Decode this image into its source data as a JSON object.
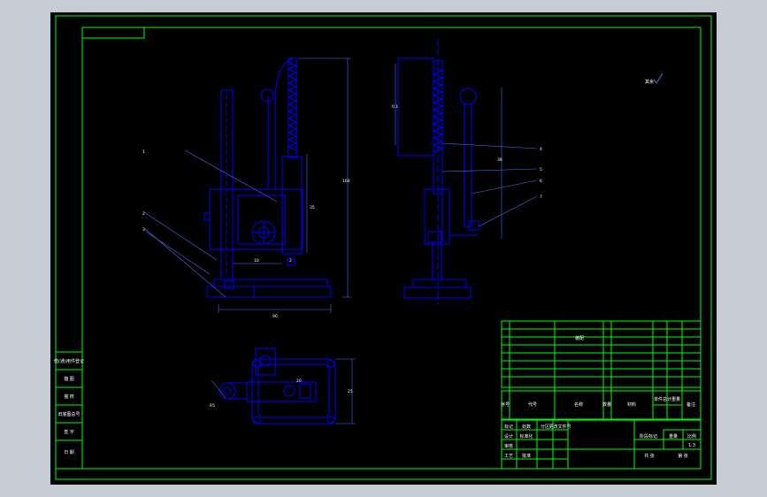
{
  "colors": {
    "frame": "#00ff00",
    "part": "#0000ff",
    "dim": "#4a6cff",
    "ink": "#ffffff",
    "background": "#000000",
    "chrome": "#c7cdd5"
  },
  "drawing": {
    "roughness_mark": "其余",
    "dimensions": {
      "front_height": "160",
      "front_width": "90",
      "front_body_height": "35",
      "front_inner_width": "10",
      "front_base_gap": "2",
      "side_spring": "0.1",
      "side_height": "38",
      "top_depth": "25",
      "top_length": "20",
      "top_radius": "R5"
    },
    "balloons": [
      "1",
      "2",
      "3",
      "4",
      "5",
      "6",
      "7",
      "8"
    ]
  },
  "left_column": [
    "借(通)用件登记",
    "描 图",
    "描 校",
    "旧底图总号",
    "签 字",
    "日 期"
  ],
  "title_block": {
    "parts_title": "装配",
    "col_seq": "序号",
    "col_code": "代号",
    "col_name": "名称",
    "col_qty": "数量",
    "col_material": "材料",
    "col_weight": "单件总计重量",
    "col_note": "备注",
    "marking": "标记",
    "count": "处数",
    "zone": "分区",
    "change_no": "更改文件号",
    "signature": "签名",
    "date": "年月日",
    "design": "设计",
    "check": "审核",
    "craft": "工艺",
    "standardize": "标准化",
    "approve": "批准",
    "stage_mark": "阶段标记",
    "weight": "重量",
    "scale": "比例",
    "scale_value": "1:3",
    "sheet_total": "共 张",
    "sheet_no": "第 张"
  }
}
